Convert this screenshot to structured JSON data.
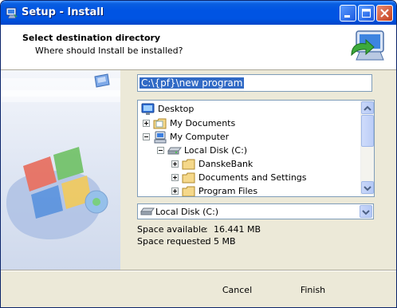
{
  "window": {
    "title": "Setup - Install"
  },
  "header": {
    "title": "Select destination directory",
    "subtitle": "Where should Install be installed?"
  },
  "path_input": {
    "value": "C:\\{pf}\\new program"
  },
  "tree": {
    "items": [
      {
        "label": "Desktop",
        "icon": "desktop-icon"
      },
      {
        "label": "My Documents",
        "icon": "folder-docs-icon"
      },
      {
        "label": "My Computer",
        "icon": "computer-icon"
      },
      {
        "label": "Local Disk (C:)",
        "icon": "drive-icon"
      },
      {
        "label": "DanskeBank",
        "icon": "folder-icon"
      },
      {
        "label": "Documents and Settings",
        "icon": "folder-icon"
      },
      {
        "label": "Program Files",
        "icon": "folder-icon"
      }
    ]
  },
  "drive_select": {
    "value": "Local Disk (C:)"
  },
  "space": {
    "available_label": "Space available",
    "available_value": "16.441 MB",
    "requested_label": "Space requested",
    "requested_value": "5 MB",
    "separator": ":"
  },
  "buttons": {
    "cancel": "Cancel",
    "finish": "Finish"
  }
}
